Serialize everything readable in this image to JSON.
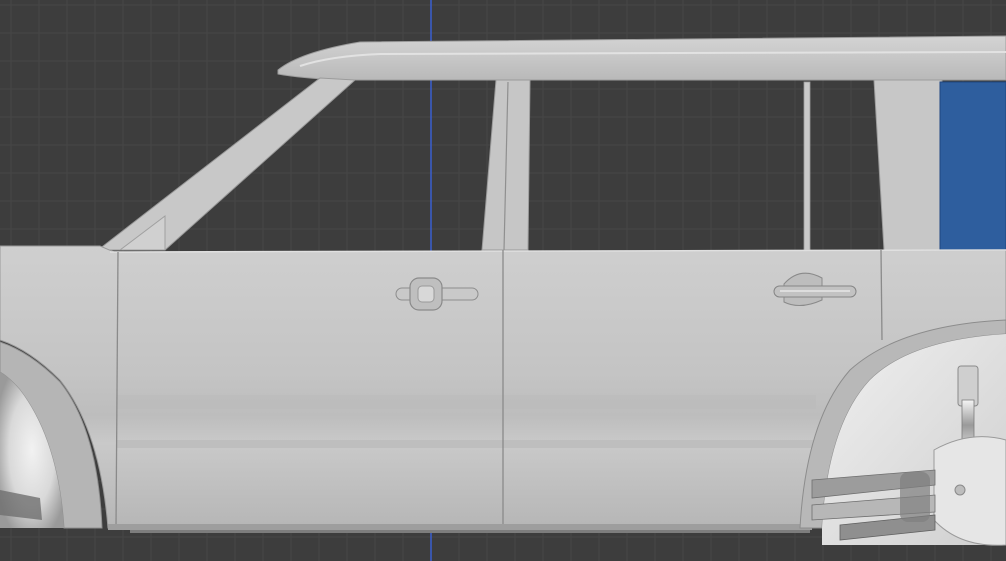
{
  "viewport": {
    "background_color": "#3d3d3d",
    "grid_minor_color": "#474747",
    "grid_major_color": "#4f4f4f",
    "axis_color": "#3a5fd0",
    "view": "side-orthographic"
  },
  "model": {
    "body_color": "#c7c7c7",
    "body_shadow_color": "#a9a9a9",
    "body_highlight_color": "#d6d6d6",
    "trim_line_color": "#8f8f8f",
    "wheel_well_color": "#e4e4e4",
    "selected_panel_color": "#2e5e9e"
  }
}
